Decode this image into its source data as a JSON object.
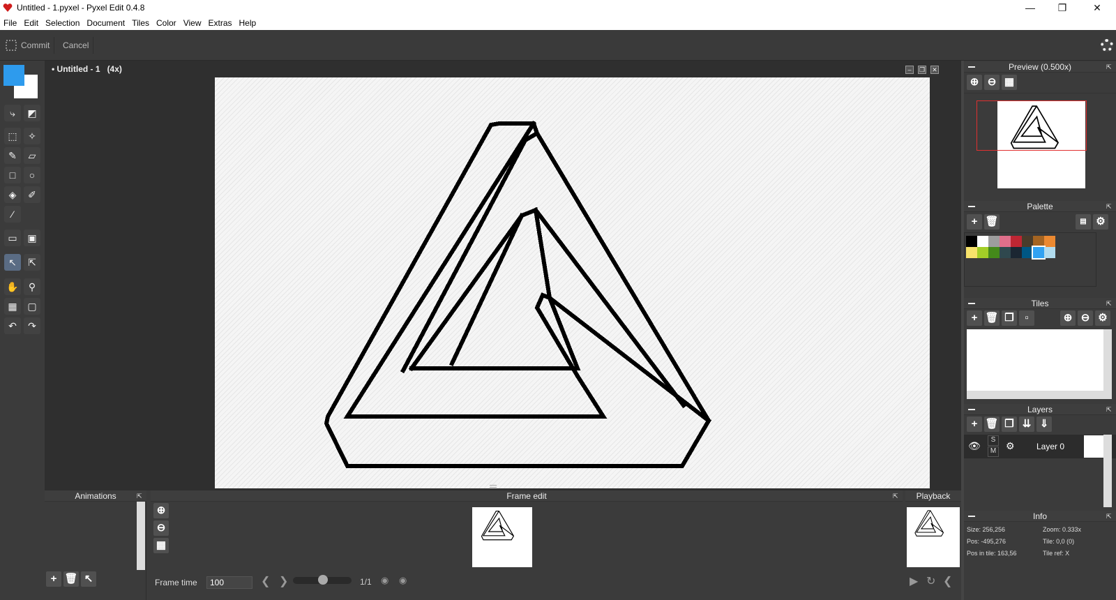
{
  "window": {
    "title": "Untitled - 1.pyxel - Pyxel Edit 0.4.8",
    "minimize_glyph": "—",
    "maximize_glyph": "❐",
    "close_glyph": "✕"
  },
  "menu": [
    "File",
    "Edit",
    "Selection",
    "Document",
    "Tiles",
    "Color",
    "View",
    "Extras",
    "Help"
  ],
  "toolbar": {
    "commit_label": "Commit",
    "cancel_label": "Cancel"
  },
  "colors": {
    "primary": "#2e9bed",
    "secondary": "#ffffff",
    "accent_selection": "#e03030"
  },
  "document": {
    "title": "• Untitled - 1",
    "zoom": "(4x)"
  },
  "panels": {
    "preview": {
      "title": "Preview (0.500x)"
    },
    "palette": {
      "title": "Palette",
      "swatches": [
        "#000000",
        "#ffffff",
        "#9d9d9d",
        "#e06f8b",
        "#be2633",
        "#493c2b",
        "#a46422",
        "#eb8931",
        "#f7e26b",
        "#a3ce27",
        "#44891a",
        "#2f484e",
        "#1b2632",
        "#005784",
        "#31a2f2",
        "#b2dcef"
      ]
    },
    "tiles": {
      "title": "Tiles"
    },
    "layers": {
      "title": "Layers",
      "items": [
        {
          "name": "Layer 0",
          "s": "S",
          "m": "M"
        }
      ]
    },
    "info": {
      "title": "Info",
      "size": "Size: 256,256",
      "zoom": "Zoom: 0.333x",
      "pos": "Pos: -495,276",
      "tile": "Tile: 0,0 (0)",
      "pos_in_tile": "Pos in tile: 163,56",
      "tile_ref": "Tile ref: X"
    },
    "animations": {
      "title": "Animations"
    },
    "frame_edit": {
      "title": "Frame edit"
    },
    "playback": {
      "title": "Playback"
    }
  },
  "frame": {
    "time_label": "Frame time",
    "time_value": "100",
    "counter": "1/1"
  }
}
